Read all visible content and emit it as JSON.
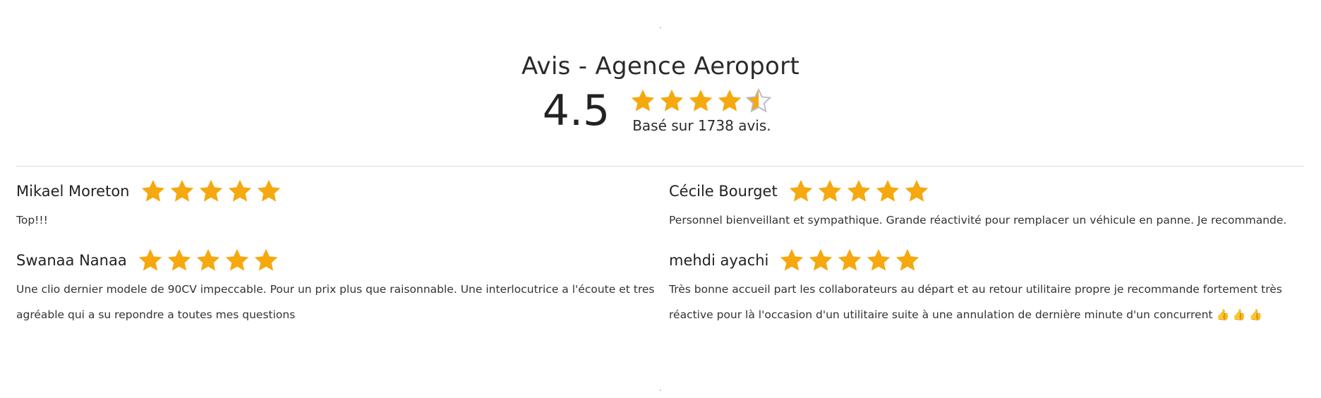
{
  "summary": {
    "title": "Avis - Agence Aeroport",
    "rating": "4.5",
    "rating_fraction": 0.9,
    "stars_filled": 4.5,
    "based_on": "Basé sur 1738 avis."
  },
  "colors": {
    "star": "#F5A90F",
    "star_empty_outline": "#B9B9C8",
    "divider": "#DDDDDD"
  },
  "reviews": [
    {
      "name": "Mikael Moreton",
      "rating": 5,
      "text": "Top!!!"
    },
    {
      "name": "Cécile Bourget",
      "rating": 5,
      "text": "Personnel bienveillant et sympathique. Grande réactivité pour remplacer un véhicule en panne. Je recommande."
    },
    {
      "name": "Swanaa Nanaa",
      "rating": 5,
      "text": "Une clio dernier modele de 90CV impeccable. Pour un prix plus que raisonnable. Une interlocutrice a l'écoute et tres agréable qui a su repondre a toutes mes questions"
    },
    {
      "name": "mehdi ayachi",
      "rating": 5,
      "text": "Très bonne accueil part les collaborateurs au départ et au retour utilitaire propre je recommande fortement très réactive pour là l'occasion d'un utilitaire suite à une annulation de dernière minute d'un concurrent",
      "emoji": "👍 👍 👍"
    }
  ]
}
